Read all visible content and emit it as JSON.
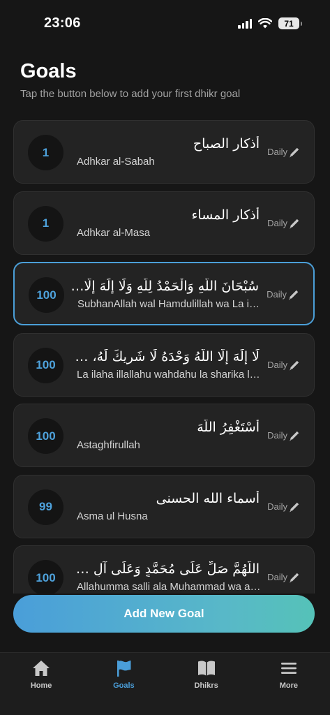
{
  "status": {
    "time": "23:06",
    "battery": "71"
  },
  "header": {
    "title": "Goals",
    "subtitle": "Tap the button below to add your first dhikr goal"
  },
  "goals": [
    {
      "count": "1",
      "arabic": "أذكار الصباح",
      "latin": "Adhkar al-Sabah",
      "frequency": "Daily",
      "selected": false
    },
    {
      "count": "1",
      "arabic": "أذكار المساء",
      "latin": "Adhkar al-Masa",
      "frequency": "Daily",
      "selected": false
    },
    {
      "count": "100",
      "arabic": "سُبْحَانَ اللَّهِ وَالْحَمْدُ لِلَّهِ وَلَا إِلَهَ إِلَّا اللَّهُ",
      "latin": "SubhanAllah wal Hamdulillah wa La ilaha illallah",
      "frequency": "Daily",
      "selected": true
    },
    {
      "count": "100",
      "arabic": "لَا إِلَهَ إِلَّا اللَّهُ وَحْدَهُ لَا شَرِيكَ لَهُ، لَهُ الْمُلْكُ",
      "latin": "La ilaha illallahu wahdahu la sharika lahu",
      "frequency": "Daily",
      "selected": false
    },
    {
      "count": "100",
      "arabic": "أَسْتَغْفِرُ اللَّهَ",
      "latin": "Astaghfirullah",
      "frequency": "Daily",
      "selected": false
    },
    {
      "count": "99",
      "arabic": "أسماء الله الحسنى",
      "latin": "Asma ul Husna",
      "frequency": "Daily",
      "selected": false
    },
    {
      "count": "100",
      "arabic": "اللَّهُمَّ صَلِّ عَلَى مُحَمَّدٍ وَعَلَى آلِ مُحَمَّدٍ",
      "latin": "Allahumma salli ala Muhammad wa ala ali Muhammad",
      "frequency": "Daily",
      "selected": false
    }
  ],
  "add_button_label": "Add New Goal",
  "tabs": [
    {
      "label": "Home",
      "icon": "home-icon",
      "active": false
    },
    {
      "label": "Goals",
      "icon": "flag-icon",
      "active": true
    },
    {
      "label": "Dhikrs",
      "icon": "book-icon",
      "active": false
    },
    {
      "label": "More",
      "icon": "menu-icon",
      "active": false
    }
  ],
  "colors": {
    "accent": "#4a9ed9",
    "background": "#161616",
    "card": "#232323"
  }
}
